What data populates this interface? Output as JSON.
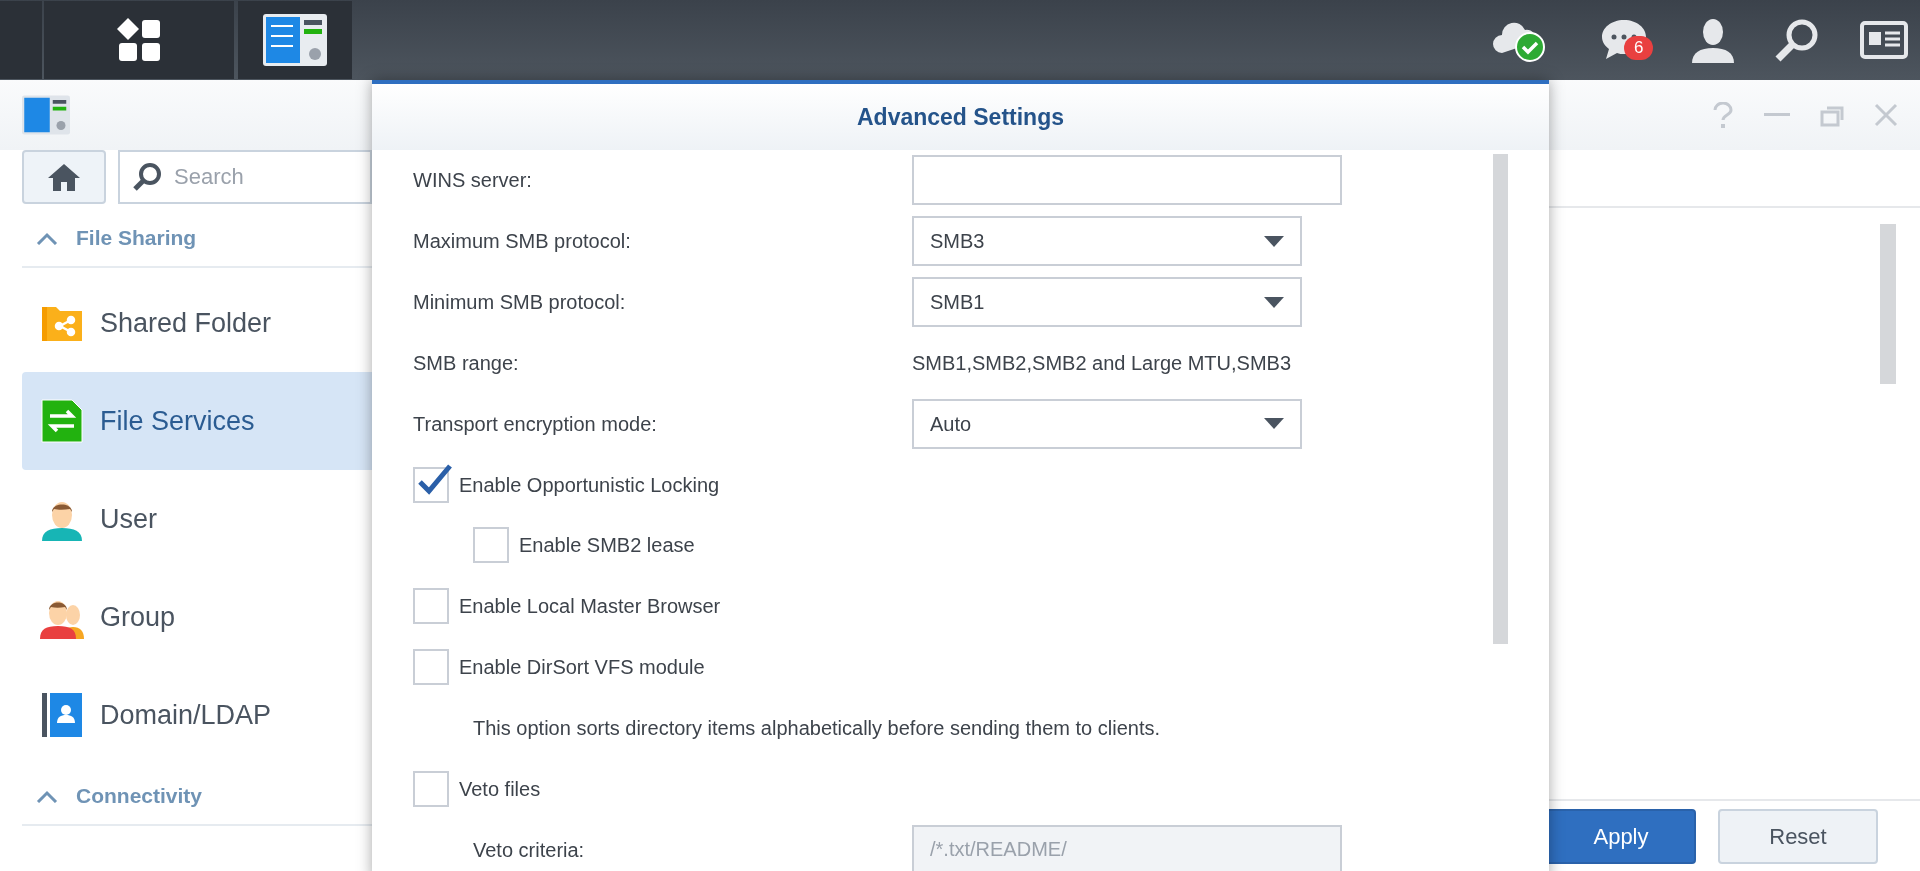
{
  "taskbar": {
    "notification_badge": "6"
  },
  "window": {
    "sidebar": {
      "search": {
        "placeholder": "Search"
      },
      "sections": [
        {
          "title": "File Sharing",
          "expanded": true,
          "items": [
            {
              "label": "Shared Folder",
              "selected": false
            },
            {
              "label": "File Services",
              "selected": true
            },
            {
              "label": "User",
              "selected": false
            },
            {
              "label": "Group",
              "selected": false
            },
            {
              "label": "Domain/LDAP",
              "selected": false
            }
          ]
        },
        {
          "title": "Connectivity",
          "expanded": true
        }
      ]
    },
    "buttons": [
      {
        "label": "Apply",
        "kind": "primary"
      },
      {
        "label": "Reset",
        "kind": "secondary"
      }
    ]
  },
  "dialog": {
    "title": "Advanced Settings",
    "fields": [
      {
        "kind": "text",
        "label": "WINS server:"
      },
      {
        "kind": "select",
        "label": "Maximum SMB protocol:",
        "value": "SMB3"
      },
      {
        "kind": "select",
        "label": "Minimum SMB protocol:",
        "value": "SMB1"
      },
      {
        "kind": "static",
        "label": "SMB range:",
        "value": "SMB1,SMB2,SMB2 and Large MTU,SMB3"
      },
      {
        "kind": "select",
        "label": "Transport encryption mode:",
        "value": "Auto"
      },
      {
        "kind": "checkbox",
        "label": "Enable Opportunistic Locking",
        "checked": true,
        "children": [
          {
            "kind": "checkbox",
            "label": "Enable SMB2 lease",
            "checked": false
          }
        ]
      },
      {
        "kind": "checkbox",
        "label": "Enable Local Master Browser",
        "checked": false
      },
      {
        "kind": "checkbox",
        "label": "Enable DirSort VFS module",
        "checked": false,
        "children": [
          {
            "kind": "note",
            "text": "This option sorts directory items alphabetically before sending them to clients."
          }
        ]
      },
      {
        "kind": "checkbox",
        "label": "Veto files",
        "checked": false,
        "children": [
          {
            "kind": "text",
            "label": "Veto criteria:",
            "value": "/*.txt/README/",
            "disabled": true
          }
        ]
      }
    ]
  }
}
